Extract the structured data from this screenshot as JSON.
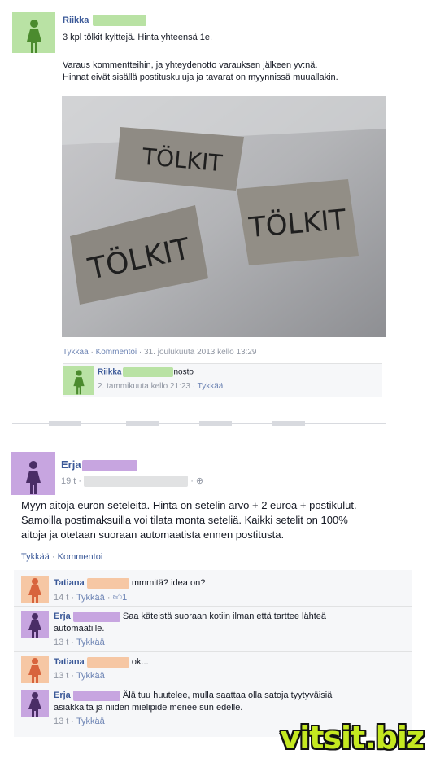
{
  "post1": {
    "author": "Riikka",
    "line1": "3 kpl tölkit kylttejä. Hinta yhteensä 1e.",
    "line2": "Varaus kommentteihin, ja yhteydenotto varauksen jälkeen yv:nä.",
    "line3": "Hinnat eivät sisällä postituskuluja ja tavarat on myynnissä muuallakin.",
    "photo_sign_text": "TÖLKIT",
    "actions": {
      "like": "Tykkää",
      "comment": "Kommentoi",
      "timestamp": "31. joulukuuta 2013 kello 13:29"
    },
    "comment": {
      "author": "Riikka",
      "text": "nosto",
      "timestamp": "2. tammikuuta kello 21:23",
      "like": "Tykkää"
    }
  },
  "post2": {
    "author": "Erja",
    "time": "19 t",
    "text1": "Myyn aitoja euron seteleitä. Hinta on setelin arvo + 2 euroa + postikulut.",
    "text2": "Samoilla postimaksuilla voi tilata monta seteliä. Kaikki setelit on 100%",
    "text3": "aitoja ja otetaan suoraan automaatista ennen postitusta.",
    "actions": {
      "like": "Tykkää",
      "comment": "Kommentoi"
    },
    "comments": [
      {
        "author": "Tatiana",
        "text": "mmmitä? idea on?",
        "time": "14 t",
        "like": "Tykkää",
        "likes": "1"
      },
      {
        "author": "Erja",
        "text1": "Saa käteistä suoraan kotiin ilman että tarttee lähteä",
        "text2": "automaatille.",
        "time": "13 t",
        "like": "Tykkää"
      },
      {
        "author": "Tatiana",
        "text": "ok...",
        "time": "13 t",
        "like": "Tykkää"
      },
      {
        "author": "Erja",
        "text1": "Älä tuu huutelee, mulla saattaa olla satoja tyytyväisiä",
        "text2": "asiakkaita ja niiden mielipide menee sun edelle.",
        "time": "13 t",
        "like": "Tykkää"
      }
    ]
  },
  "watermark": "vitsit.biz",
  "colors": {
    "link": "#3b5998",
    "green_avatar": "#b9e2a4",
    "purple_avatar": "#c7a5e0",
    "orange_avatar": "#f6c7a4",
    "watermark": "#c4e820"
  }
}
